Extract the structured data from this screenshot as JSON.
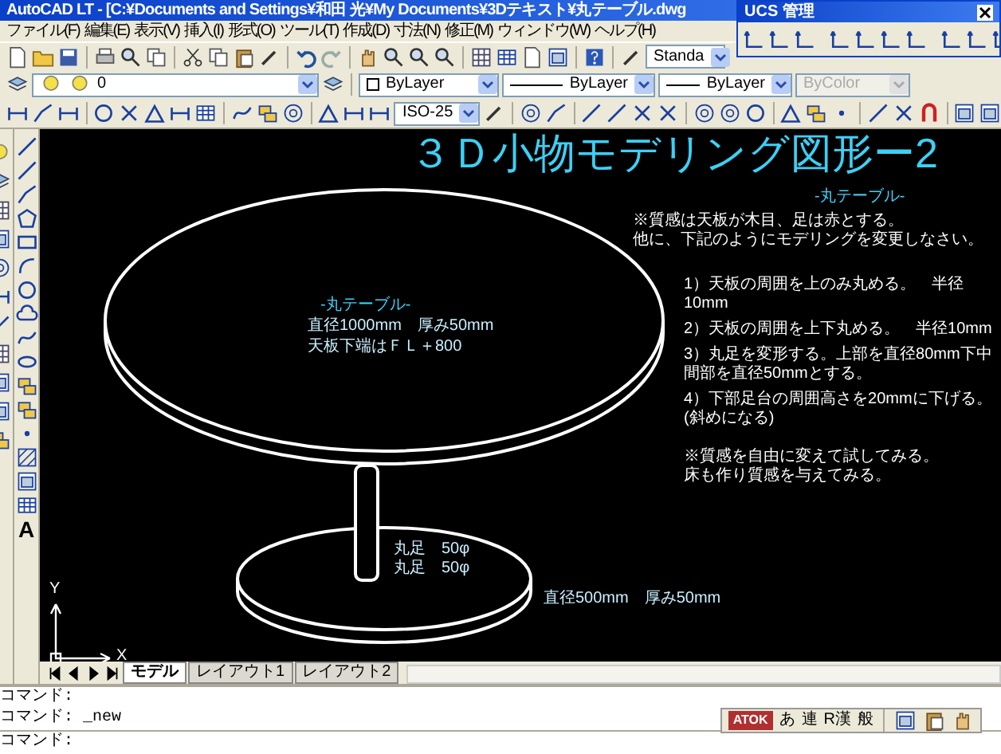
{
  "window": {
    "title": "AutoCAD LT - [C:¥Documents and Settings¥和田 光¥My Documents¥3Dテキスト¥丸テーブル.dwg"
  },
  "menu": [
    "ファイル(F)",
    "編集(E)",
    "表示(V)",
    "挿入(I)",
    "形式(O)",
    "ツール(T)",
    "作成(D)",
    "寸法(N)",
    "修正(M)",
    "ウィンドウ(W)",
    "ヘルプ(H)"
  ],
  "toolbar": {
    "text_style": "Standa",
    "layer": "0",
    "color_control": "ByLayer",
    "linetype": "ByLayer",
    "lineweight": "ByLayer",
    "plot_style": {
      "value": "ByColor",
      "disabled": true
    },
    "dim_style": "ISO-25"
  },
  "ucs_panel": {
    "title": "UCS 管理"
  },
  "draw_toolbar": {
    "text_tool": "A"
  },
  "drawing": {
    "title": "３Ｄ小物モデリング図形ー2",
    "heading": "-丸テーブル-",
    "intro": [
      "※質感は天板が木目、足は赤とする。",
      "他に、下記のようにモデリングを変更しなさい。"
    ],
    "steps": [
      "1）天板の周囲を上のみ丸める。　半径10mm",
      "2）天板の周囲を上下丸める。　半径10mm",
      "3）丸足を変形する。上部を直径80mm下中間部を直径50mmとする。",
      "4）下部足台の周囲高さを20mmに下げる。(斜めになる)"
    ],
    "note": [
      "※質感を自由に変えて試してみる。",
      "床も作り質感を与えてみる。"
    ],
    "table_labels": [
      "-丸テーブル-",
      "直径1000mm　厚み50mm",
      "天板下端はＦＬ＋800"
    ],
    "leg_labels": [
      "丸足　50φ",
      "丸足　50φ"
    ],
    "base_label": "直径500mm　厚み50mm",
    "axes": {
      "x": "X",
      "y": "Y"
    }
  },
  "layout_tabs": [
    {
      "label": "モデル",
      "selected": true
    },
    {
      "label": "レイアウト1",
      "selected": false
    },
    {
      "label": "レイアウト2",
      "selected": false
    }
  ],
  "command_lines": [
    "コマンド:",
    "コマンド: _new"
  ],
  "command_prompt": "コマンド:",
  "ime_bar": {
    "mode": "ATOK",
    "items": [
      "あ",
      "連",
      "R漢",
      "般"
    ]
  }
}
